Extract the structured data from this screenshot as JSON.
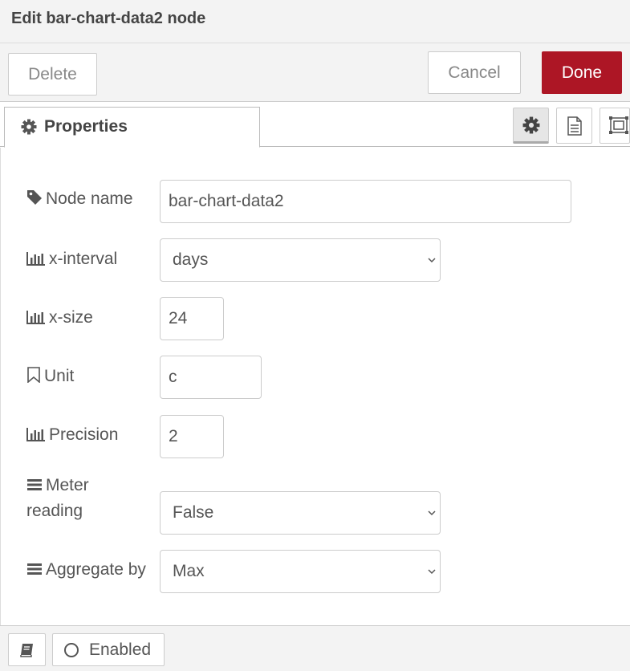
{
  "dialog": {
    "title": "Edit bar-chart-data2 node"
  },
  "toolbar": {
    "delete_label": "Delete",
    "cancel_label": "Cancel",
    "done_label": "Done",
    "done_color": "#ad1625"
  },
  "tabs": {
    "properties_label": "Properties"
  },
  "form": {
    "node_name": {
      "label": "Node name",
      "value": "bar-chart-data2",
      "icon": "tag-icon"
    },
    "x_interval": {
      "label": "x-interval",
      "value": "days",
      "icon": "bar-chart-icon"
    },
    "x_size": {
      "label": "x-size",
      "value": "24",
      "icon": "bar-chart-icon"
    },
    "unit": {
      "label": "Unit",
      "value": "c",
      "icon": "bookmark-icon"
    },
    "precision": {
      "label": "Precision",
      "value": "2",
      "icon": "bar-chart-icon"
    },
    "meter_reading": {
      "label_line1": "Meter",
      "label_line2": "reading",
      "value": "False",
      "icon": "bars-icon"
    },
    "aggregate_by": {
      "label": "Aggregate by",
      "value": "Max",
      "icon": "bars-icon"
    }
  },
  "footer": {
    "enabled_label": "Enabled"
  }
}
